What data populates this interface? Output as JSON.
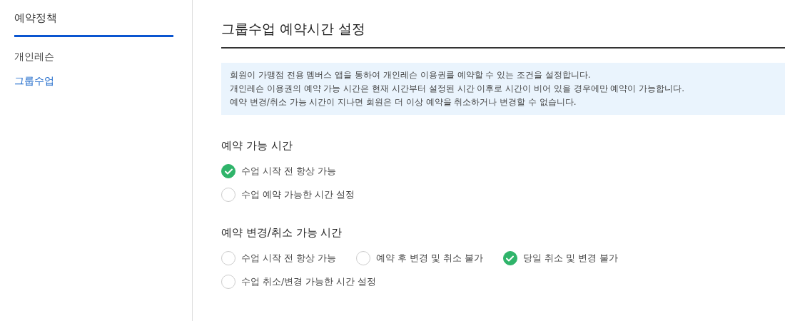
{
  "sidebar": {
    "title": "예약정책",
    "items": [
      {
        "label": "개인레슨",
        "selected": false
      },
      {
        "label": "그룹수업",
        "selected": true
      }
    ]
  },
  "main": {
    "title": "그룹수업 예약시간 설정",
    "notice": [
      "회원이 가맹점 전용 멤버스 앱을 통하여 개인레슨 이용권를 예약할 수 있는 조건을 설정합니다.",
      "개인레슨 이용권의 예약 가능 시간은 현재 시간부터 설정된 시간 이후로 시간이 비어 있을 경우에만 예약이 가능합니다.",
      "예약 변경/취소 가능 시간이 지나면 회원은 더 이상 예약을 취소하거나 변경할 수 없습니다."
    ],
    "sections": [
      {
        "heading": "예약 가능 시간",
        "rows": [
          [
            {
              "label": "수업 시작 전 항상 가능",
              "selected": true
            }
          ],
          [
            {
              "label": "수업 예약 가능한 시간 설정",
              "selected": false
            }
          ]
        ]
      },
      {
        "heading": "예약 변경/취소 가능 시간",
        "rows": [
          [
            {
              "label": "수업 시작 전 항상 가능",
              "selected": false
            },
            {
              "label": "예약 후 변경 및 취소 불가",
              "selected": false
            },
            {
              "label": "당일 취소 및 변경 불가",
              "selected": true
            }
          ],
          [
            {
              "label": "수업 취소/변경 가능한 시간 설정",
              "selected": false
            }
          ]
        ]
      }
    ]
  }
}
